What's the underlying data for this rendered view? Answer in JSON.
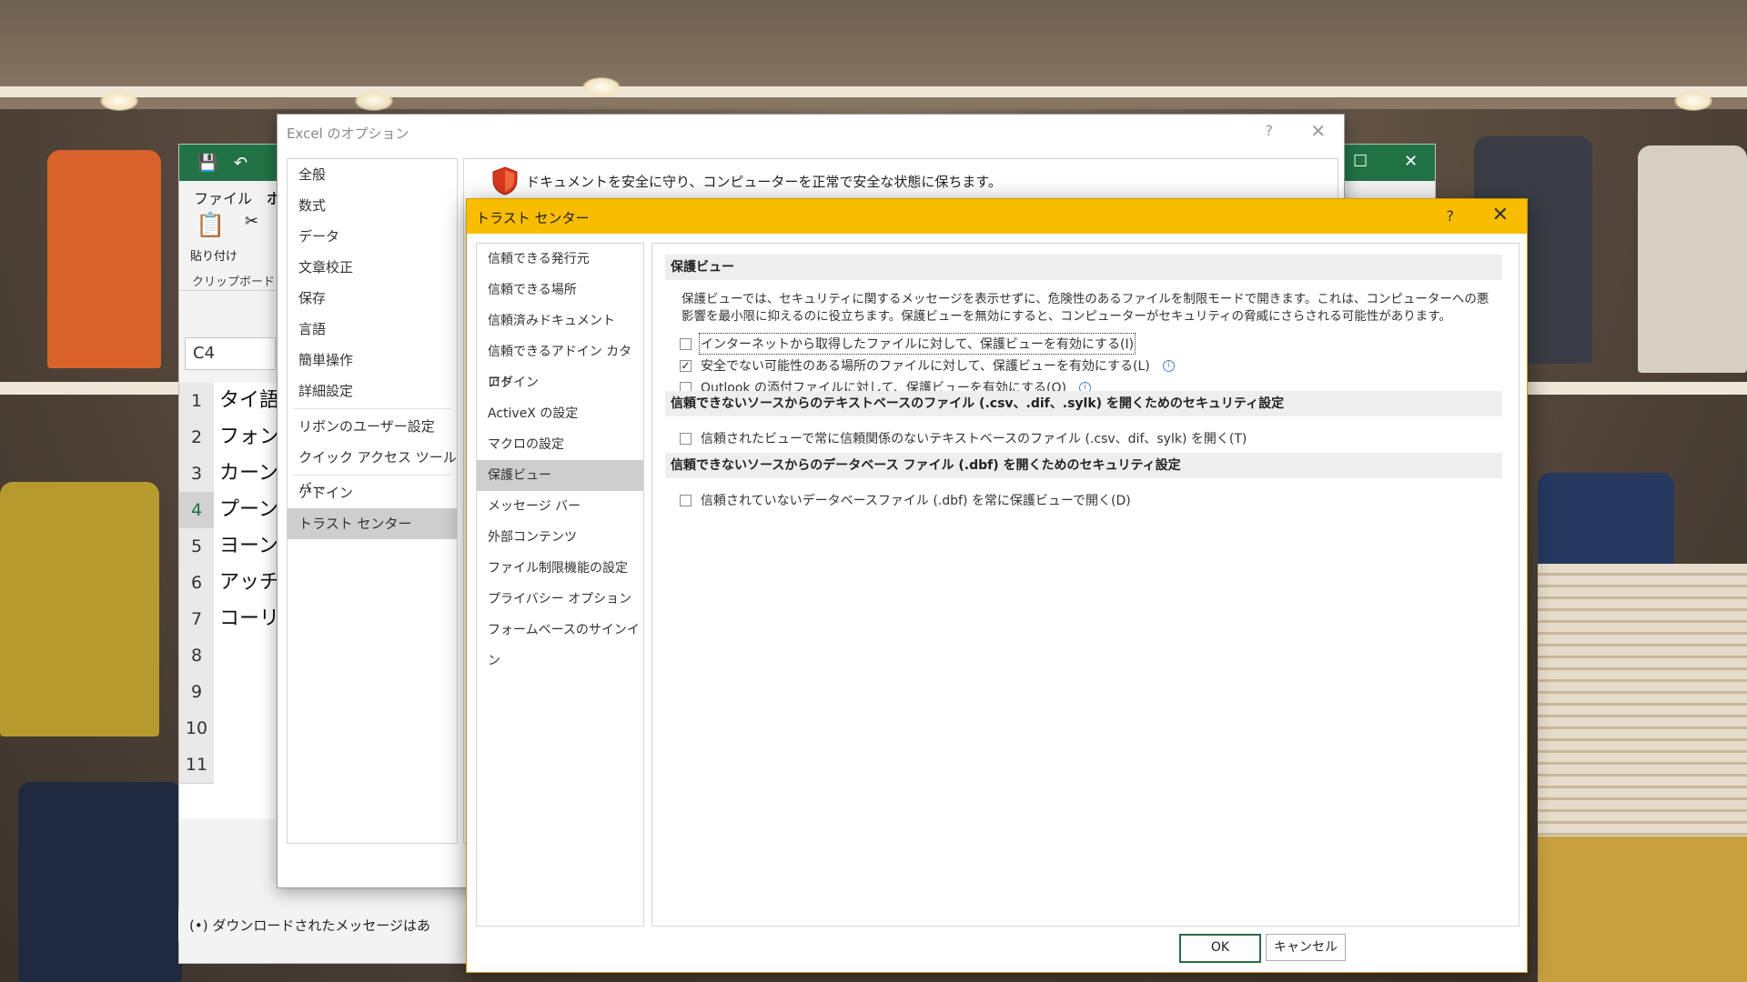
{
  "excel": {
    "window_partial_title": "ファイル",
    "tab_file": "ファイル",
    "tab_home": "ホ",
    "paste_label": "貼り付け",
    "clipboard_group": "クリップボード",
    "namebox_value": "C4",
    "rows": [
      {
        "num": "1",
        "text": "タイ語"
      },
      {
        "num": "2",
        "text": "フォン"
      },
      {
        "num": "3",
        "text": "カーン"
      },
      {
        "num": "4",
        "text": "プーン"
      },
      {
        "num": "5",
        "text": "ヨーン"
      },
      {
        "num": "6",
        "text": "アッチ"
      },
      {
        "num": "7",
        "text": "コーリ"
      },
      {
        "num": "8",
        "text": ""
      },
      {
        "num": "9",
        "text": ""
      },
      {
        "num": "10",
        "text": ""
      },
      {
        "num": "11",
        "text": ""
      }
    ],
    "notification": "ダウンロードされたメッセージはあ"
  },
  "options_dialog": {
    "title": "Excel のオプション",
    "help": "?",
    "close": "✕",
    "nav": [
      "全般",
      "数式",
      "データ",
      "文章校正",
      "保存",
      "言語",
      "簡単操作",
      "詳細設定",
      "リボンのユーザー設定",
      "クイック アクセス ツール バー",
      "アドイン",
      "トラスト センター"
    ],
    "selected": "トラスト センター",
    "header_text": "ドキュメントを安全に守り、コンピューターを正常で安全な状態に保ちます。"
  },
  "trust_center": {
    "title": "トラスト センター",
    "help": "?",
    "close": "✕",
    "nav": [
      "信頼できる発行元",
      "信頼できる場所",
      "信頼済みドキュメント",
      "信頼できるアドイン カタログ",
      "アドイン",
      "ActiveX の設定",
      "マクロの設定",
      "保護ビュー",
      "メッセージ バー",
      "外部コンテンツ",
      "ファイル制限機能の設定",
      "プライバシー オプション",
      "フォームベースのサインイン"
    ],
    "selected": "保護ビュー",
    "section1": {
      "title": "保護ビュー",
      "description": "保護ビューでは、セキュリティに関するメッセージを表示せずに、危険性のあるファイルを制限モードで開きます。これは、コンピューターへの悪影響を最小限に抑えるのに役立ちます。保護ビューを無効にすると、コンピューターがセキュリティの脅威にさらされる可能性があります。",
      "options": [
        {
          "label": "インターネットから取得したファイルに対して、保護ビューを有効にする(I)",
          "checked": false,
          "info": false
        },
        {
          "label": "安全でない可能性のある場所のファイルに対して、保護ビューを有効にする(L)",
          "checked": true,
          "info": true
        },
        {
          "label": "Outlook の添付ファイルに対して、保護ビューを有効にする(O)",
          "checked": false,
          "info": true
        }
      ]
    },
    "section2": {
      "title": "信頼できないソースからのテキストベースのファイル (.csv、.dif、.sylk) を開くためのセキュリティ設定",
      "option": "信頼されたビューで常に信頼関係のないテキストベースのファイル (.csv、dif、sylk) を開く(T)"
    },
    "section3": {
      "title": "信頼できないソースからのデータベース ファイル (.dbf) を開くためのセキュリティ設定",
      "option": "信頼されていないデータベースファイル (.dbf) を常に保護ビューで開く(D)"
    },
    "ok": "OK",
    "cancel": "キャンセル"
  },
  "colors": {
    "excel_green": "#217346",
    "trust_center_title": "#f9bd00",
    "selected_nav": "#cecece"
  }
}
